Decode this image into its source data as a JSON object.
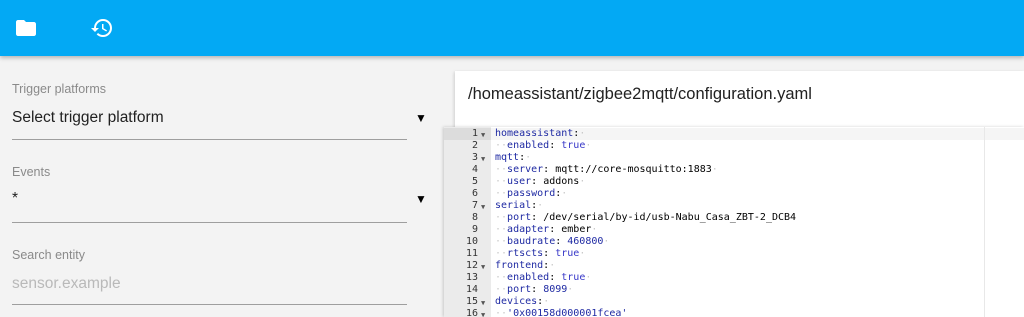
{
  "toolbar": {
    "folder_icon": "folder-icon",
    "history_icon": "history-icon",
    "background_color": "#03a9f4"
  },
  "left_panel": {
    "trigger": {
      "label": "Trigger platforms",
      "value": "Select trigger platform",
      "arrow": "▼"
    },
    "events": {
      "label": "Events",
      "value": "*",
      "arrow": "▼"
    },
    "search": {
      "label": "Search entity",
      "placeholder": "sensor.example"
    }
  },
  "editor": {
    "file_path": "/homeassistant/zigbee2mqtt/configuration.yaml",
    "lines": [
      {
        "n": "1",
        "fold": true,
        "indent": "",
        "key": "homeassistant",
        "sep": ":",
        "val": "",
        "vtype": "",
        "eol": "·"
      },
      {
        "n": "2",
        "fold": false,
        "indent": "··",
        "key": "enabled",
        "sep": ":",
        "val": " true",
        "vtype": "bool",
        "eol": "·"
      },
      {
        "n": "3",
        "fold": true,
        "indent": "",
        "key": "mqtt",
        "sep": ":",
        "val": "",
        "vtype": "",
        "eol": "·"
      },
      {
        "n": "4",
        "fold": false,
        "indent": "··",
        "key": "server",
        "sep": ":",
        "val": " mqtt://core-mosquitto:1883",
        "vtype": "str",
        "eol": "·"
      },
      {
        "n": "5",
        "fold": false,
        "indent": "··",
        "key": "user",
        "sep": ":",
        "val": " addons",
        "vtype": "str",
        "eol": "·"
      },
      {
        "n": "6",
        "fold": false,
        "indent": "··",
        "key": "password",
        "sep": ":",
        "val": "",
        "vtype": "",
        "eol": "·"
      },
      {
        "n": "7",
        "fold": true,
        "indent": "",
        "key": "serial",
        "sep": ":",
        "val": "",
        "vtype": "",
        "eol": "·"
      },
      {
        "n": "8",
        "fold": false,
        "indent": "··",
        "key": "port",
        "sep": ":",
        "val": " /dev/serial/by-id/usb-Nabu_Casa_ZBT-2_DCB4",
        "vtype": "str",
        "eol": ""
      },
      {
        "n": "9",
        "fold": false,
        "indent": "··",
        "key": "adapter",
        "sep": ":",
        "val": " ember",
        "vtype": "str",
        "eol": "·"
      },
      {
        "n": "10",
        "fold": false,
        "indent": "··",
        "key": "baudrate",
        "sep": ":",
        "val": " 460800",
        "vtype": "num",
        "eol": "·"
      },
      {
        "n": "11",
        "fold": false,
        "indent": "··",
        "key": "rtscts",
        "sep": ":",
        "val": " true",
        "vtype": "bool",
        "eol": "·"
      },
      {
        "n": "12",
        "fold": true,
        "indent": "",
        "key": "frontend",
        "sep": ":",
        "val": "",
        "vtype": "",
        "eol": "·"
      },
      {
        "n": "13",
        "fold": false,
        "indent": "··",
        "key": "enabled",
        "sep": ":",
        "val": " true",
        "vtype": "bool",
        "eol": "·"
      },
      {
        "n": "14",
        "fold": false,
        "indent": "··",
        "key": "port",
        "sep": ":",
        "val": " 8099",
        "vtype": "num",
        "eol": "·"
      },
      {
        "n": "15",
        "fold": true,
        "indent": "",
        "key": "devices",
        "sep": ":",
        "val": "",
        "vtype": "",
        "eol": "·"
      },
      {
        "n": "16",
        "fold": true,
        "indent": "··",
        "key": "'0x00158d000001fcea'",
        "sep": "",
        "val": "",
        "vtype": "",
        "eol": ""
      }
    ]
  }
}
